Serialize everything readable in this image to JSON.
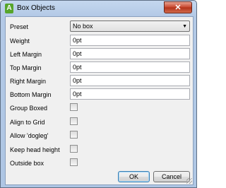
{
  "window": {
    "title": "Box Objects",
    "app_icon_letter": "A",
    "close_symbol": "✕"
  },
  "fields": {
    "preset": {
      "label": "Preset",
      "value": "No box"
    },
    "weight": {
      "label": "Weight",
      "value": "0pt"
    },
    "left_margin": {
      "label": "Left Margin",
      "value": "0pt"
    },
    "top_margin": {
      "label": "Top Margin",
      "value": "0pt"
    },
    "right_margin": {
      "label": "Right Margin",
      "value": "0pt"
    },
    "bottom_margin": {
      "label": "Bottom Margin",
      "value": "0pt"
    }
  },
  "checkboxes": {
    "group_boxed": {
      "label": "Group Boxed",
      "checked": false
    },
    "align_to_grid": {
      "label": "Align to Grid",
      "checked": false
    },
    "allow_dogleg": {
      "label": "Allow 'dogleg'",
      "checked": false
    },
    "keep_head_height": {
      "label": "Keep head height",
      "checked": false
    },
    "outside_box": {
      "label": "Outside box",
      "checked": false
    }
  },
  "buttons": {
    "ok": "OK",
    "cancel": "Cancel"
  },
  "icons": {
    "dropdown_arrow": "▼"
  }
}
